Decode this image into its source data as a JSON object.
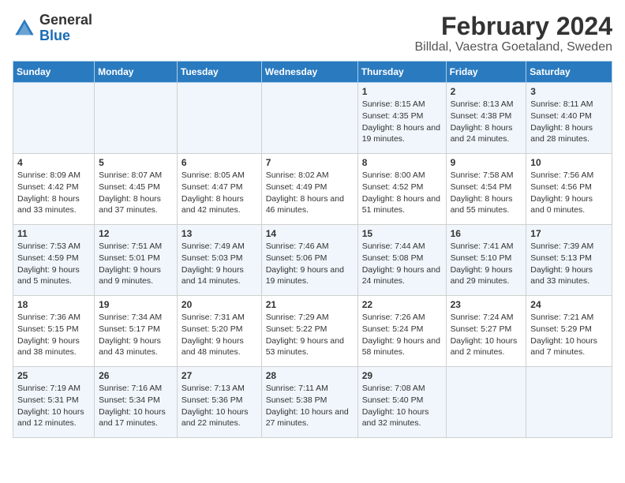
{
  "header": {
    "logo_general": "General",
    "logo_blue": "Blue",
    "title": "February 2024",
    "subtitle": "Billdal, Vaestra Goetaland, Sweden"
  },
  "weekdays": [
    "Sunday",
    "Monday",
    "Tuesday",
    "Wednesday",
    "Thursday",
    "Friday",
    "Saturday"
  ],
  "weeks": [
    [
      {
        "day": "",
        "info": ""
      },
      {
        "day": "",
        "info": ""
      },
      {
        "day": "",
        "info": ""
      },
      {
        "day": "",
        "info": ""
      },
      {
        "day": "1",
        "info": "Sunrise: 8:15 AM\nSunset: 4:35 PM\nDaylight: 8 hours\nand 19 minutes."
      },
      {
        "day": "2",
        "info": "Sunrise: 8:13 AM\nSunset: 4:38 PM\nDaylight: 8 hours\nand 24 minutes."
      },
      {
        "day": "3",
        "info": "Sunrise: 8:11 AM\nSunset: 4:40 PM\nDaylight: 8 hours\nand 28 minutes."
      }
    ],
    [
      {
        "day": "4",
        "info": "Sunrise: 8:09 AM\nSunset: 4:42 PM\nDaylight: 8 hours\nand 33 minutes."
      },
      {
        "day": "5",
        "info": "Sunrise: 8:07 AM\nSunset: 4:45 PM\nDaylight: 8 hours\nand 37 minutes."
      },
      {
        "day": "6",
        "info": "Sunrise: 8:05 AM\nSunset: 4:47 PM\nDaylight: 8 hours\nand 42 minutes."
      },
      {
        "day": "7",
        "info": "Sunrise: 8:02 AM\nSunset: 4:49 PM\nDaylight: 8 hours\nand 46 minutes."
      },
      {
        "day": "8",
        "info": "Sunrise: 8:00 AM\nSunset: 4:52 PM\nDaylight: 8 hours\nand 51 minutes."
      },
      {
        "day": "9",
        "info": "Sunrise: 7:58 AM\nSunset: 4:54 PM\nDaylight: 8 hours\nand 55 minutes."
      },
      {
        "day": "10",
        "info": "Sunrise: 7:56 AM\nSunset: 4:56 PM\nDaylight: 9 hours\nand 0 minutes."
      }
    ],
    [
      {
        "day": "11",
        "info": "Sunrise: 7:53 AM\nSunset: 4:59 PM\nDaylight: 9 hours\nand 5 minutes."
      },
      {
        "day": "12",
        "info": "Sunrise: 7:51 AM\nSunset: 5:01 PM\nDaylight: 9 hours\nand 9 minutes."
      },
      {
        "day": "13",
        "info": "Sunrise: 7:49 AM\nSunset: 5:03 PM\nDaylight: 9 hours\nand 14 minutes."
      },
      {
        "day": "14",
        "info": "Sunrise: 7:46 AM\nSunset: 5:06 PM\nDaylight: 9 hours\nand 19 minutes."
      },
      {
        "day": "15",
        "info": "Sunrise: 7:44 AM\nSunset: 5:08 PM\nDaylight: 9 hours\nand 24 minutes."
      },
      {
        "day": "16",
        "info": "Sunrise: 7:41 AM\nSunset: 5:10 PM\nDaylight: 9 hours\nand 29 minutes."
      },
      {
        "day": "17",
        "info": "Sunrise: 7:39 AM\nSunset: 5:13 PM\nDaylight: 9 hours\nand 33 minutes."
      }
    ],
    [
      {
        "day": "18",
        "info": "Sunrise: 7:36 AM\nSunset: 5:15 PM\nDaylight: 9 hours\nand 38 minutes."
      },
      {
        "day": "19",
        "info": "Sunrise: 7:34 AM\nSunset: 5:17 PM\nDaylight: 9 hours\nand 43 minutes."
      },
      {
        "day": "20",
        "info": "Sunrise: 7:31 AM\nSunset: 5:20 PM\nDaylight: 9 hours\nand 48 minutes."
      },
      {
        "day": "21",
        "info": "Sunrise: 7:29 AM\nSunset: 5:22 PM\nDaylight: 9 hours\nand 53 minutes."
      },
      {
        "day": "22",
        "info": "Sunrise: 7:26 AM\nSunset: 5:24 PM\nDaylight: 9 hours\nand 58 minutes."
      },
      {
        "day": "23",
        "info": "Sunrise: 7:24 AM\nSunset: 5:27 PM\nDaylight: 10 hours\nand 2 minutes."
      },
      {
        "day": "24",
        "info": "Sunrise: 7:21 AM\nSunset: 5:29 PM\nDaylight: 10 hours\nand 7 minutes."
      }
    ],
    [
      {
        "day": "25",
        "info": "Sunrise: 7:19 AM\nSunset: 5:31 PM\nDaylight: 10 hours\nand 12 minutes."
      },
      {
        "day": "26",
        "info": "Sunrise: 7:16 AM\nSunset: 5:34 PM\nDaylight: 10 hours\nand 17 minutes."
      },
      {
        "day": "27",
        "info": "Sunrise: 7:13 AM\nSunset: 5:36 PM\nDaylight: 10 hours\nand 22 minutes."
      },
      {
        "day": "28",
        "info": "Sunrise: 7:11 AM\nSunset: 5:38 PM\nDaylight: 10 hours\nand 27 minutes."
      },
      {
        "day": "29",
        "info": "Sunrise: 7:08 AM\nSunset: 5:40 PM\nDaylight: 10 hours\nand 32 minutes."
      },
      {
        "day": "",
        "info": ""
      },
      {
        "day": "",
        "info": ""
      }
    ]
  ]
}
